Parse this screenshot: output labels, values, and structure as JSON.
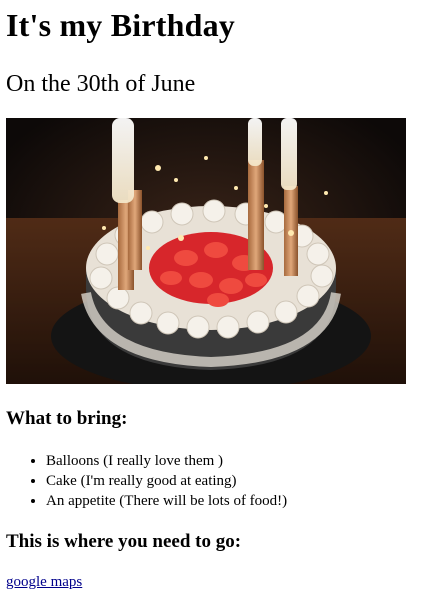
{
  "header": {
    "title": "It's my Birthday",
    "subtitle": "On the 30th of June"
  },
  "hero_image": {
    "alt": "Birthday cake with candles"
  },
  "bring_section": {
    "heading": "What to bring:",
    "items": [
      "Balloons (I really love them )",
      "Cake (I'm really good at eating)",
      "An appetite (There will be lots of food!)"
    ]
  },
  "location_section": {
    "heading": "This is where you need to go:",
    "link_text": "google maps"
  }
}
